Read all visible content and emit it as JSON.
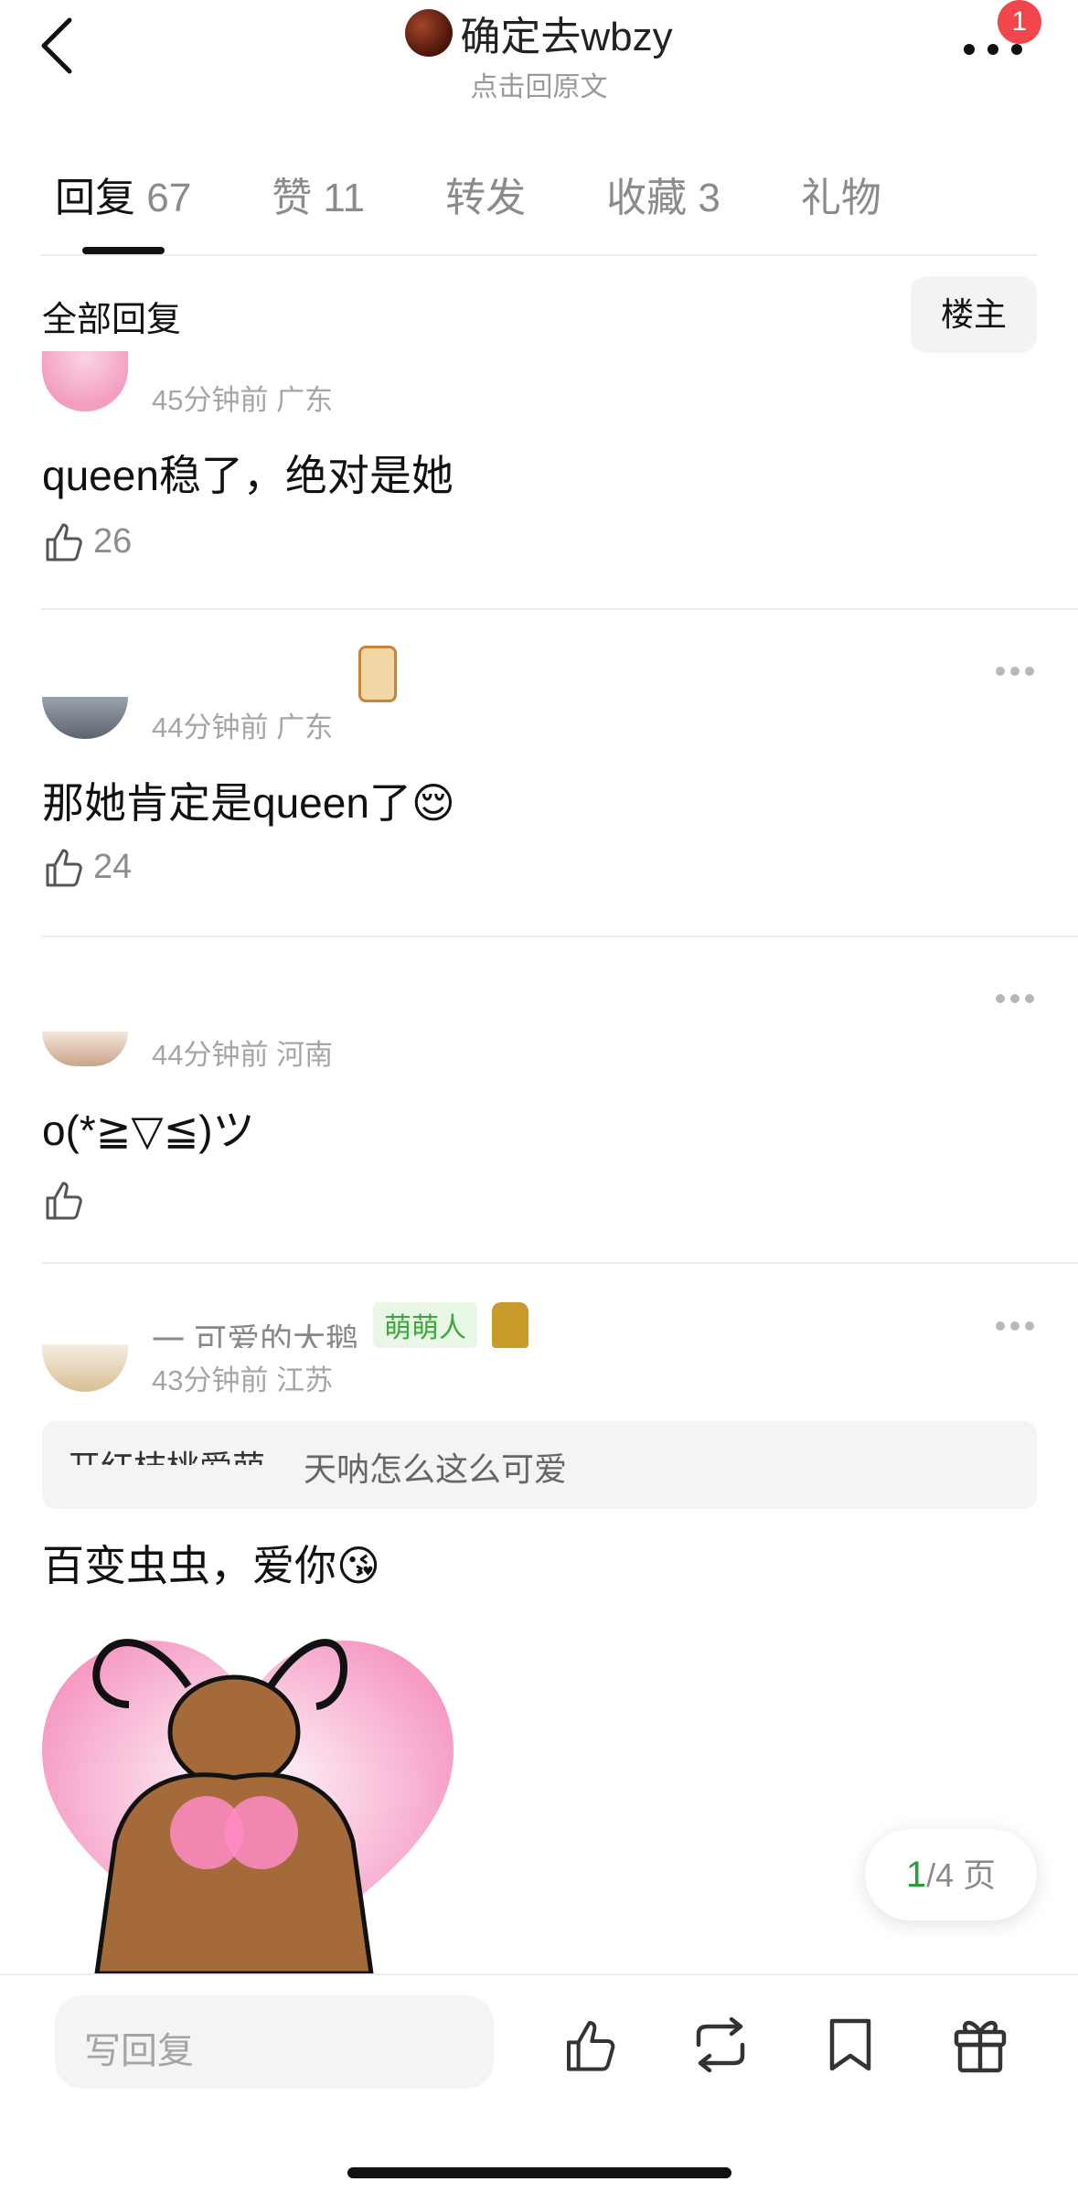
{
  "header": {
    "title": "确定去wbzy",
    "subtitle": "点击回原文",
    "notification_count": "1"
  },
  "tabs": [
    {
      "label": "回复",
      "count": "67",
      "active": true
    },
    {
      "label": "赞",
      "count": "11",
      "active": false
    },
    {
      "label": "转发",
      "count": "",
      "active": false
    },
    {
      "label": "收藏",
      "count": "3",
      "active": false
    },
    {
      "label": "礼物",
      "count": "",
      "active": false
    }
  ],
  "section": {
    "title": "全部回复",
    "owner_filter": "楼主"
  },
  "comments": [
    {
      "time": "45分钟前",
      "location": "广东",
      "text": "queen稳了，绝对是她",
      "likes": "26"
    },
    {
      "time": "44分钟前",
      "location": "广东",
      "text": "那她肯定是queen了",
      "emoji": "😌",
      "likes": "24"
    },
    {
      "time": "44分钟前",
      "location": "河南",
      "text": "o(*≧▽≦)ツ",
      "likes": ""
    },
    {
      "username": "一 可爱的大鹅",
      "tag": "萌萌人",
      "time": "43分钟前",
      "location": "江苏",
      "quote_prefix": "开红桔桃爱萌",
      "quote": "天呐怎么这么可爱",
      "text": "百变虫虫，爱你",
      "emoji": "😘"
    }
  ],
  "pager": {
    "current": "1",
    "total": "/4 页"
  },
  "bottom_bar": {
    "reply_placeholder": "写回复"
  },
  "colors": {
    "accent_green": "#2a9c3a",
    "badge_red": "#f0464c",
    "tag_green": "#3aa93a"
  }
}
